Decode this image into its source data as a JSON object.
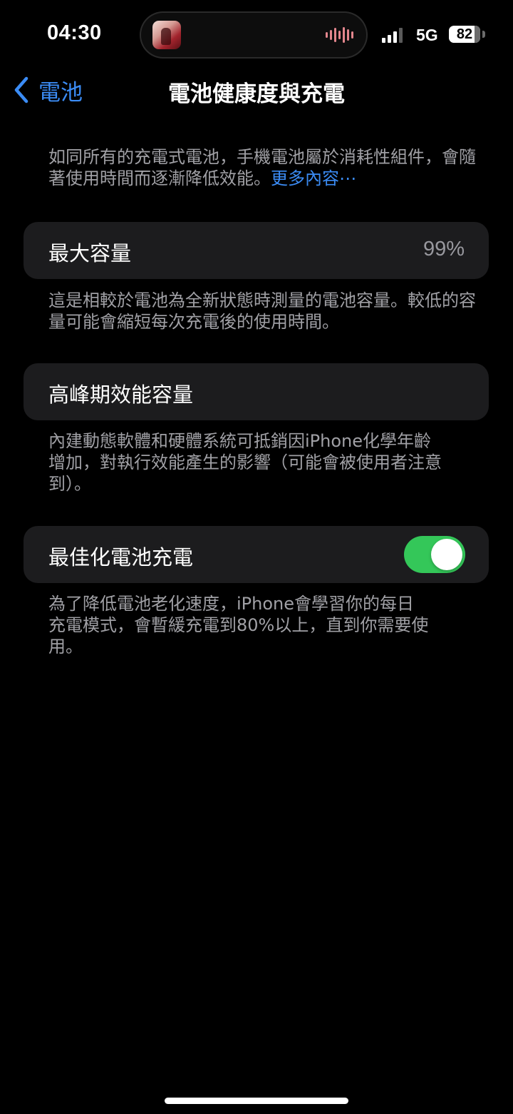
{
  "status_bar": {
    "time": "04:30",
    "network": "5G",
    "battery_level": "82",
    "signal_bars_active": 3,
    "signal_bars_total": 4,
    "now_playing_icon": "album-art-icon",
    "waveform_icon": "audio-waveform-icon"
  },
  "nav": {
    "back_label": "電池",
    "back_icon": "chevron-left-icon",
    "title": "電池健康度與充電"
  },
  "intro": {
    "text": "如同所有的充電式電池，手機電池屬於消耗性組件，會隨著使用時間而逐漸降低效能。",
    "link": "更多內容⋯"
  },
  "max_capacity": {
    "label": "最大容量",
    "value": "99%",
    "description": "這是相較於電池為全新狀態時測量的電池容量。較低的容量可能會縮短每次充電後的使用時間。"
  },
  "peak_performance": {
    "label": "高峰期效能容量",
    "description": "內建動態軟體和硬體系統可抵銷因iPhone化學年齡增加，對執行效能產生的影響（可能會被使用者注意到）。"
  },
  "optimized_charging": {
    "label": "最佳化電池充電",
    "enabled": true,
    "description": "為了降低電池老化速度，iPhone會學習你的每日充電模式，會暫緩充電到80%以上，直到你需要使用。"
  },
  "colors": {
    "accent": "#3b8cf5",
    "toggle_on": "#34c759",
    "cell_background": "#1c1c1e",
    "secondary_text": "#a0a0a5"
  }
}
